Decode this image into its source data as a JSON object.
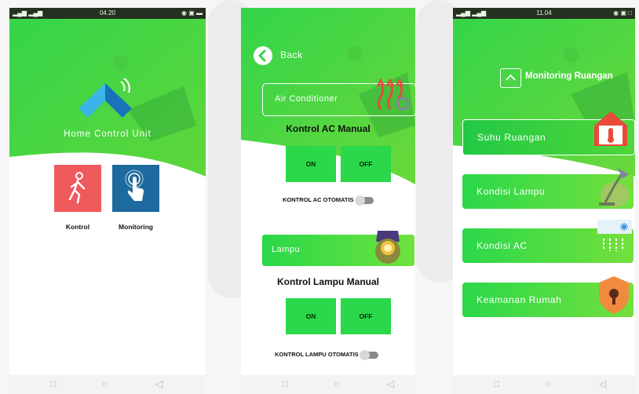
{
  "colors": {
    "green": "#2ad84a",
    "red_tile": "#ef5a5c",
    "blue_tile": "#1c6a9e"
  },
  "phone1": {
    "status": {
      "signal": "▂▄▆ ▂▄▆",
      "time": "04.20",
      "icons": "◉ ▣ ▬"
    },
    "app_title": "Home Control Unit",
    "tiles": [
      {
        "label": "Kontrol",
        "icon": "walking-person-icon"
      },
      {
        "label": "Monitoring",
        "icon": "touch-hand-icon"
      }
    ],
    "nav": {
      "square": "□",
      "circle": "○",
      "back": "◁"
    }
  },
  "phone2": {
    "back_label": "Back",
    "ac": {
      "label": "Air Conditioner",
      "title": "Kontrol AC Manual",
      "on": "ON",
      "off": "OFF",
      "auto": "KONTROL AC OTOMATIS"
    },
    "lamp": {
      "label": "Lampu",
      "title": "Kontrol Lampu Manual",
      "on": "ON",
      "off": "OFF",
      "auto": "KONTROL LAMPU OTOMATIS"
    },
    "nav": {
      "square": "□",
      "circle": "○",
      "back": "◁"
    }
  },
  "phone3": {
    "status": {
      "signal": "▂▄▆ ▂▄▆",
      "time": "11.04",
      "icons": "◉ ▣ □"
    },
    "title": "Monitoring Ruangan",
    "cards": [
      {
        "label": "Suhu Ruangan",
        "icon": "thermometer-house-icon"
      },
      {
        "label": "Kondisi Lampu",
        "icon": "desk-lamp-icon"
      },
      {
        "label": "Kondisi AC",
        "icon": "air-conditioner-icon"
      },
      {
        "label": "Keamanan Rumah",
        "icon": "security-shield-icon"
      }
    ],
    "nav": {
      "square": "□",
      "circle": "○",
      "back": "◁"
    }
  }
}
